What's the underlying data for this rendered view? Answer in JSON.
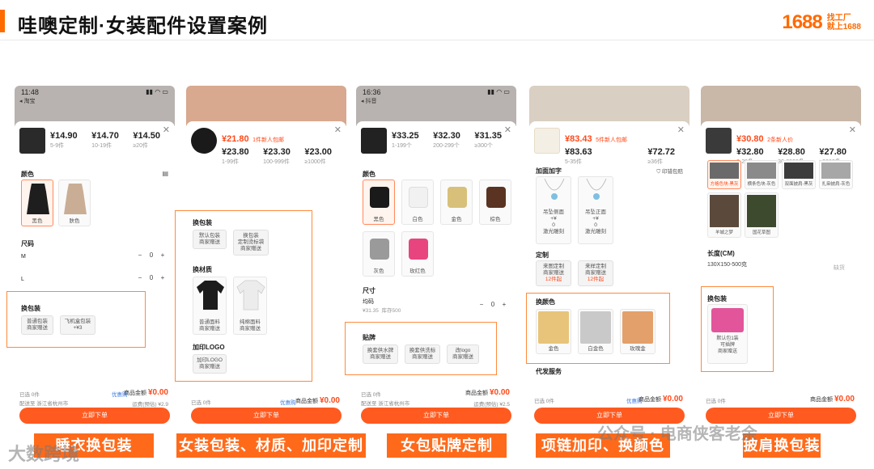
{
  "header": {
    "title": "哇噢定制·女装配件设置案例",
    "logo_number": "1688",
    "logo_tag_line1": "找工厂",
    "logo_tag_line2": "就上1688"
  },
  "panels": [
    {
      "status_time": "11:48",
      "back_label": "淘宝",
      "tiers": [
        {
          "price": "¥14.90",
          "qty": "5-9件"
        },
        {
          "price": "¥14.70",
          "qty": "10-19件"
        },
        {
          "price": "¥14.50",
          "qty": "≥20件"
        }
      ],
      "color_label": "颜色",
      "colors": [
        "黑色",
        "肤色"
      ],
      "size_label": "尺码",
      "sizes": [
        "M",
        "L"
      ],
      "size_qty": "0",
      "pack_label": "换包装",
      "pack_options": [
        {
          "line1": "普通包装",
          "line2": "商家赠送"
        },
        {
          "line1": "飞机盒包装",
          "line2": "+¥3"
        }
      ],
      "foot_selected": "已选 0件",
      "foot_ship": "配送至 浙江省杭州市",
      "foot_total_label": "商品金额",
      "foot_total": "¥0.00",
      "foot_freight": "运费(预估) ¥2.9",
      "foot_badge": "优惠购",
      "buy_label": "立即下单",
      "caption": "睡衣换包装"
    },
    {
      "tiers": [
        {
          "price": "¥21.80",
          "qty": "1件新人包邮"
        },
        {
          "price": "¥23.80",
          "qty": "1-99件"
        },
        {
          "price": "¥23.30",
          "qty": "100-999件"
        },
        {
          "price": "¥23.00",
          "qty": "≥1000件"
        }
      ],
      "pack_label": "换包装",
      "pack_options": [
        {
          "line1": "默认包装",
          "line2": "商家赠送"
        },
        {
          "line1": "换包装",
          "line2": "定制烫标袋",
          "line3": "商家赠送"
        }
      ],
      "material_label": "换材质",
      "materials": [
        {
          "line1": "普通面料",
          "line2": "商家赠送"
        },
        {
          "line1": "纯棉面料",
          "line2": "商家赠送"
        }
      ],
      "logo_label": "加印LOGO",
      "logo_option": {
        "line1": "加印LOGO",
        "line2": "商家赠送"
      },
      "foot_selected": "已选 0件",
      "foot_total_label": "商品金额",
      "foot_total": "¥0.00",
      "foot_badge": "优惠购",
      "buy_label": "立即下单",
      "caption": "女装包装、材质、加印定制"
    },
    {
      "status_time": "16:36",
      "back_label": "抖音",
      "tiers": [
        {
          "price": "¥33.25",
          "qty": "1-199个"
        },
        {
          "price": "¥32.30",
          "qty": "200-299个"
        },
        {
          "price": "¥31.35",
          "qty": "≥300个"
        }
      ],
      "color_label": "颜色",
      "colors": [
        "黑色",
        "白色",
        "金色",
        "棕色",
        "灰色",
        "玫红色"
      ],
      "size_label": "尺寸",
      "size_name": "均码",
      "size_price": "¥31.35",
      "size_stock": "库存500",
      "size_qty": "0",
      "tag_label": "贴牌",
      "tag_options": [
        {
          "line1": "换套供水牌",
          "line2": "商家赠送"
        },
        {
          "line1": "换套供洗标",
          "line2": "商家赠送"
        },
        {
          "line1": "改logo",
          "line2": "商家赠送"
        }
      ],
      "foot_selected": "已选 0件",
      "foot_ship": "配送至 浙江省杭州市",
      "foot_total_label": "商品金额",
      "foot_total": "¥0.00",
      "foot_freight": "运费(预估) ¥2.5",
      "buy_label": "立即下单",
      "caption": "女包贴牌定制"
    },
    {
      "tiers": [
        {
          "price": "¥83.43",
          "qty": "5件新人包邮"
        },
        {
          "price": "¥83.63",
          "qty": "5-35件"
        },
        {
          "price": "¥72.72",
          "qty": "≥36件"
        }
      ],
      "engrave_label": "加面加字",
      "engrave_side": "印错包赔",
      "engrave_options": [
        {
          "line1": "吊坠侧面",
          "line2": "+¥",
          "line3": "0",
          "line4": "激光雕刻"
        },
        {
          "line1": "吊坠正面",
          "line2": "+¥",
          "line3": "0",
          "line4": "激光雕刻"
        }
      ],
      "custom_label": "定制",
      "custom_options": [
        {
          "line1": "来图定制",
          "line2": "商家赠送",
          "line3": "12件起"
        },
        {
          "line1": "来样定制",
          "line2": "商家赠送",
          "line3": "12件起"
        }
      ],
      "recolor_label": "换颜色",
      "recolors": [
        "金色",
        "白金色",
        "玫瑰金"
      ],
      "service_label": "代发服务",
      "foot_selected": "已选 0件",
      "foot_total_label": "商品金额",
      "foot_total": "¥0.00",
      "foot_badge": "优惠购",
      "buy_label": "立即下单",
      "caption": "项链加印、换颜色"
    },
    {
      "tiers": [
        {
          "price": "¥30.80",
          "qty": "2条新人价"
        },
        {
          "price": "¥32.80",
          "qty": "2-29条"
        },
        {
          "price": "¥28.80",
          "qty": "30-2999条"
        },
        {
          "price": "¥27.80",
          "qty": "≥3000条"
        }
      ],
      "style_options": [
        "方格色块-黑灰",
        "横条色块-灰色",
        "双面披肩-黑灰",
        "扎染披肩-灰色"
      ],
      "style_options2": [
        "羊城之梦",
        "国花草图"
      ],
      "length_label": "长度(CM)",
      "length_value": "130X150-500克",
      "length_stock": "缺货",
      "pack_label": "换包装",
      "pack_option": {
        "line1": "默认包1装",
        "line2": "可插牌",
        "line3": "商家赠送"
      },
      "foot_selected": "已选 0件",
      "foot_total_label": "商品金额",
      "foot_total": "¥0.00",
      "buy_label": "立即下单",
      "caption": "披肩换包装"
    }
  ],
  "watermarks": {
    "left": "大数跨境",
    "right": "公众号 · 电商侠客老余"
  },
  "colors": {
    "accent": "#ff6a00",
    "caption_bg": "#ff6a1a",
    "buy_bg": "#ff5a1f",
    "price_red": "#ff4a1a"
  }
}
